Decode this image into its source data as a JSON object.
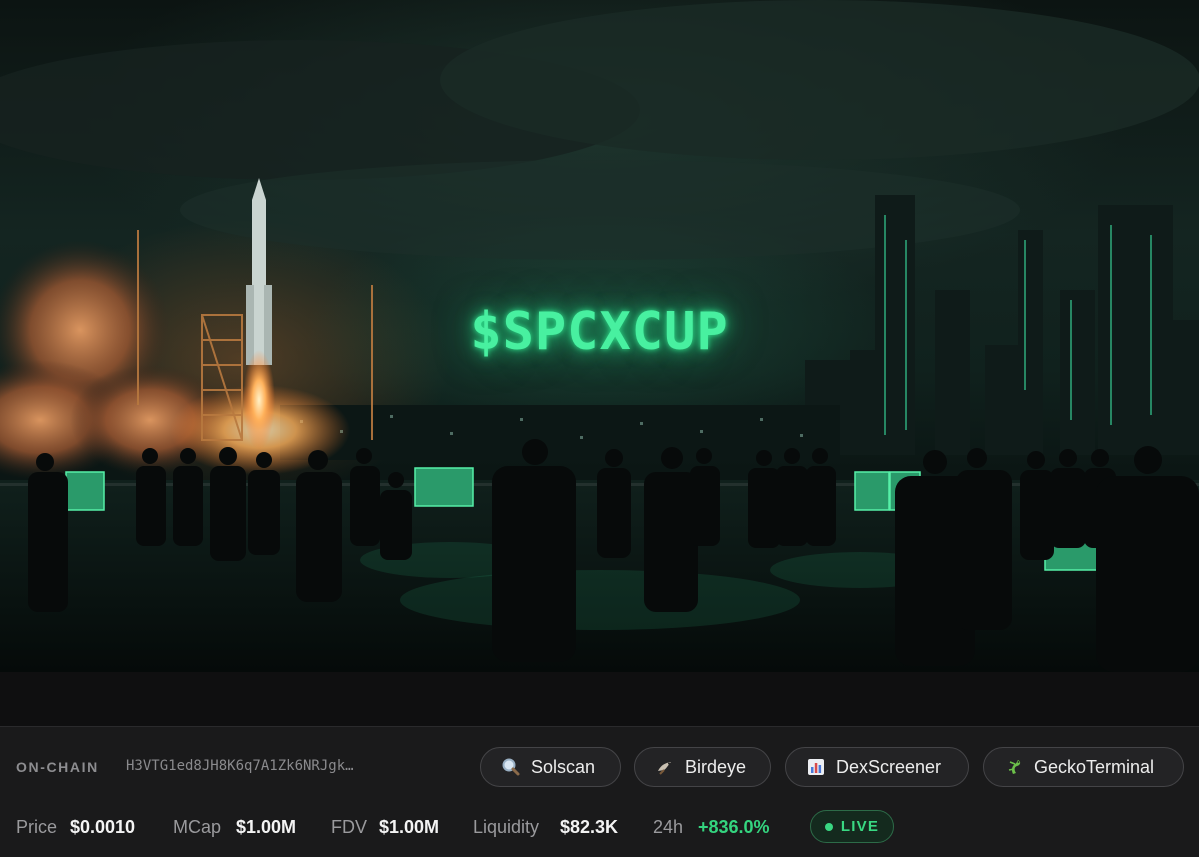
{
  "hero": {
    "title": "$SPCXCUP"
  },
  "onchain": {
    "label": "ON-CHAIN",
    "address": "H3VTG1ed8JH8K6q7A1Zk6NRJgk…"
  },
  "links": [
    {
      "label": "Solscan",
      "icon": "magnifier-icon"
    },
    {
      "label": "Birdeye",
      "icon": "bird-icon"
    },
    {
      "label": "DexScreener",
      "icon": "bar-chart-icon"
    },
    {
      "label": "GeckoTerminal",
      "icon": "gecko-icon"
    }
  ],
  "stats": {
    "price_label": "Price",
    "price_value": "$0.0010",
    "mcap_label": "MCap",
    "mcap_value": "$1.00M",
    "fdv_label": "FDV",
    "fdv_value": "$1.00M",
    "liquidity_label": "Liquidity",
    "liquidity_value": "$82.3K",
    "change_label": "24h",
    "change_value": "+836.0%"
  },
  "status": {
    "live_label": "LIVE"
  },
  "colors": {
    "accent_green": "#34d47f",
    "hero_glow": "#48f0a0",
    "panel_bg": "#1a1a1b"
  }
}
